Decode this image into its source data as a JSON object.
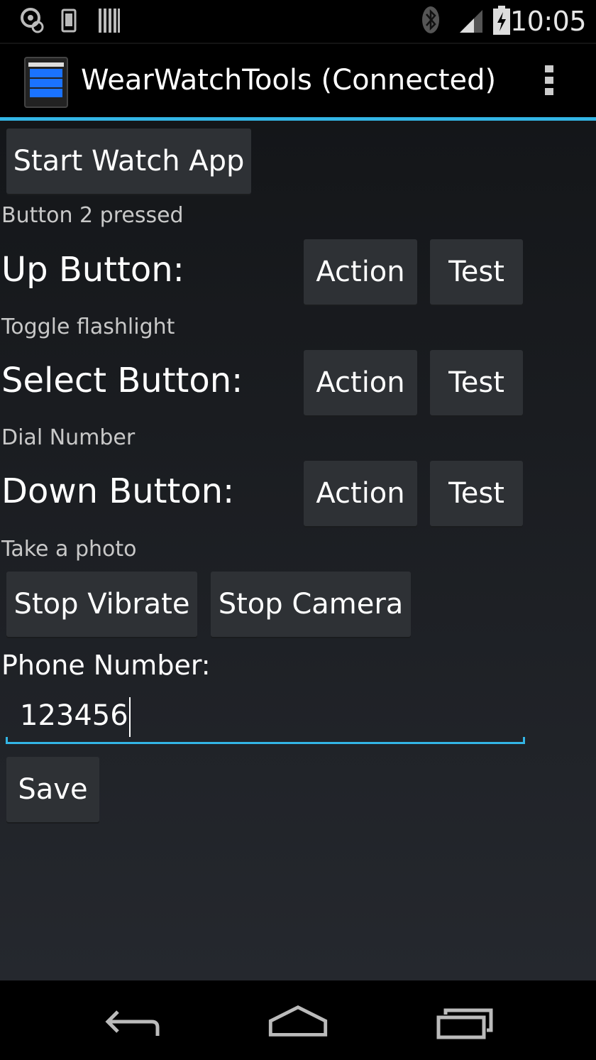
{
  "status_bar": {
    "clock": "10:05",
    "left_icons": [
      "settings-notification-icon",
      "phone-icon",
      "barcode-icon"
    ],
    "right_icons": [
      "bluetooth-icon",
      "signal-icon",
      "battery-charging-icon"
    ]
  },
  "action_bar": {
    "title": "WearWatchTools (Connected)",
    "app_icon": {
      "title": "Wear Watch Tools(Connected)",
      "buttons": [
        "UP",
        "SELECT",
        "DOWN"
      ]
    },
    "overflow_icon": "overflow-menu-icon",
    "accent_color": "#33b5e5"
  },
  "main": {
    "start_button": "Start Watch App",
    "status_text": "Button 2 pressed",
    "rows": [
      {
        "label": "Up Button:",
        "action": "Action",
        "test": "Test",
        "description": "Toggle flashlight"
      },
      {
        "label": "Select Button:",
        "action": "Action",
        "test": "Test",
        "description": "Dial Number"
      },
      {
        "label": "Down Button:",
        "action": "Action",
        "test": "Test",
        "description": "Take a photo"
      }
    ],
    "stop_vibrate": "Stop Vibrate",
    "stop_camera": "Stop Camera",
    "phone_label": "Phone Number:",
    "phone_value": "123456",
    "save_button": "Save"
  },
  "nav_bar": {
    "icons": [
      "back-icon",
      "home-icon",
      "recent-apps-icon"
    ]
  }
}
